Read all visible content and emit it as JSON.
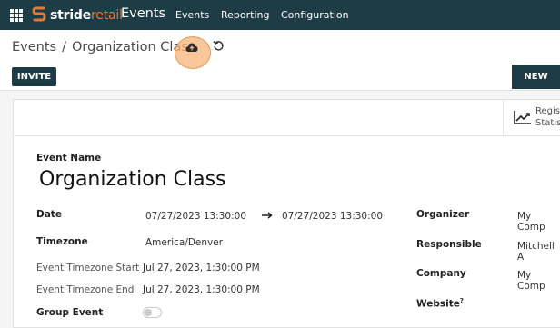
{
  "topbar": {
    "brand_stride": "stride",
    "brand_retail": "retail",
    "app_title": "Events",
    "menu": [
      "Events",
      "Reporting",
      "Configuration"
    ],
    "bg": "#1e3c46",
    "accent": "#e07a3a"
  },
  "breadcrumb": {
    "parent": "Events",
    "separator": "/",
    "current": "Organization Class"
  },
  "actions": {
    "invite": "INVITE",
    "new": "NEW"
  },
  "smart_button": {
    "line1": "Regist",
    "line2": "Statist"
  },
  "form": {
    "event_name_label": "Event Name",
    "event_name": "Organization Class",
    "date_label": "Date",
    "date_start": "07/27/2023 13:30:00",
    "date_end": "07/27/2023 13:30:00",
    "timezone_label": "Timezone",
    "timezone": "America/Denver",
    "tz_start_label": "Event Timezone Start",
    "tz_start": "Jul 27, 2023, 1:30:00 PM",
    "tz_end_label": "Event Timezone End",
    "tz_end": "Jul 27, 2023, 1:30:00 PM",
    "group_event_label": "Group Event",
    "organizer_label": "Organizer",
    "organizer": "My Comp",
    "responsible_label": "Responsible",
    "responsible": "Mitchell A",
    "company_label": "Company",
    "company": "My Comp",
    "website_label": "Website",
    "website_help": "?"
  }
}
